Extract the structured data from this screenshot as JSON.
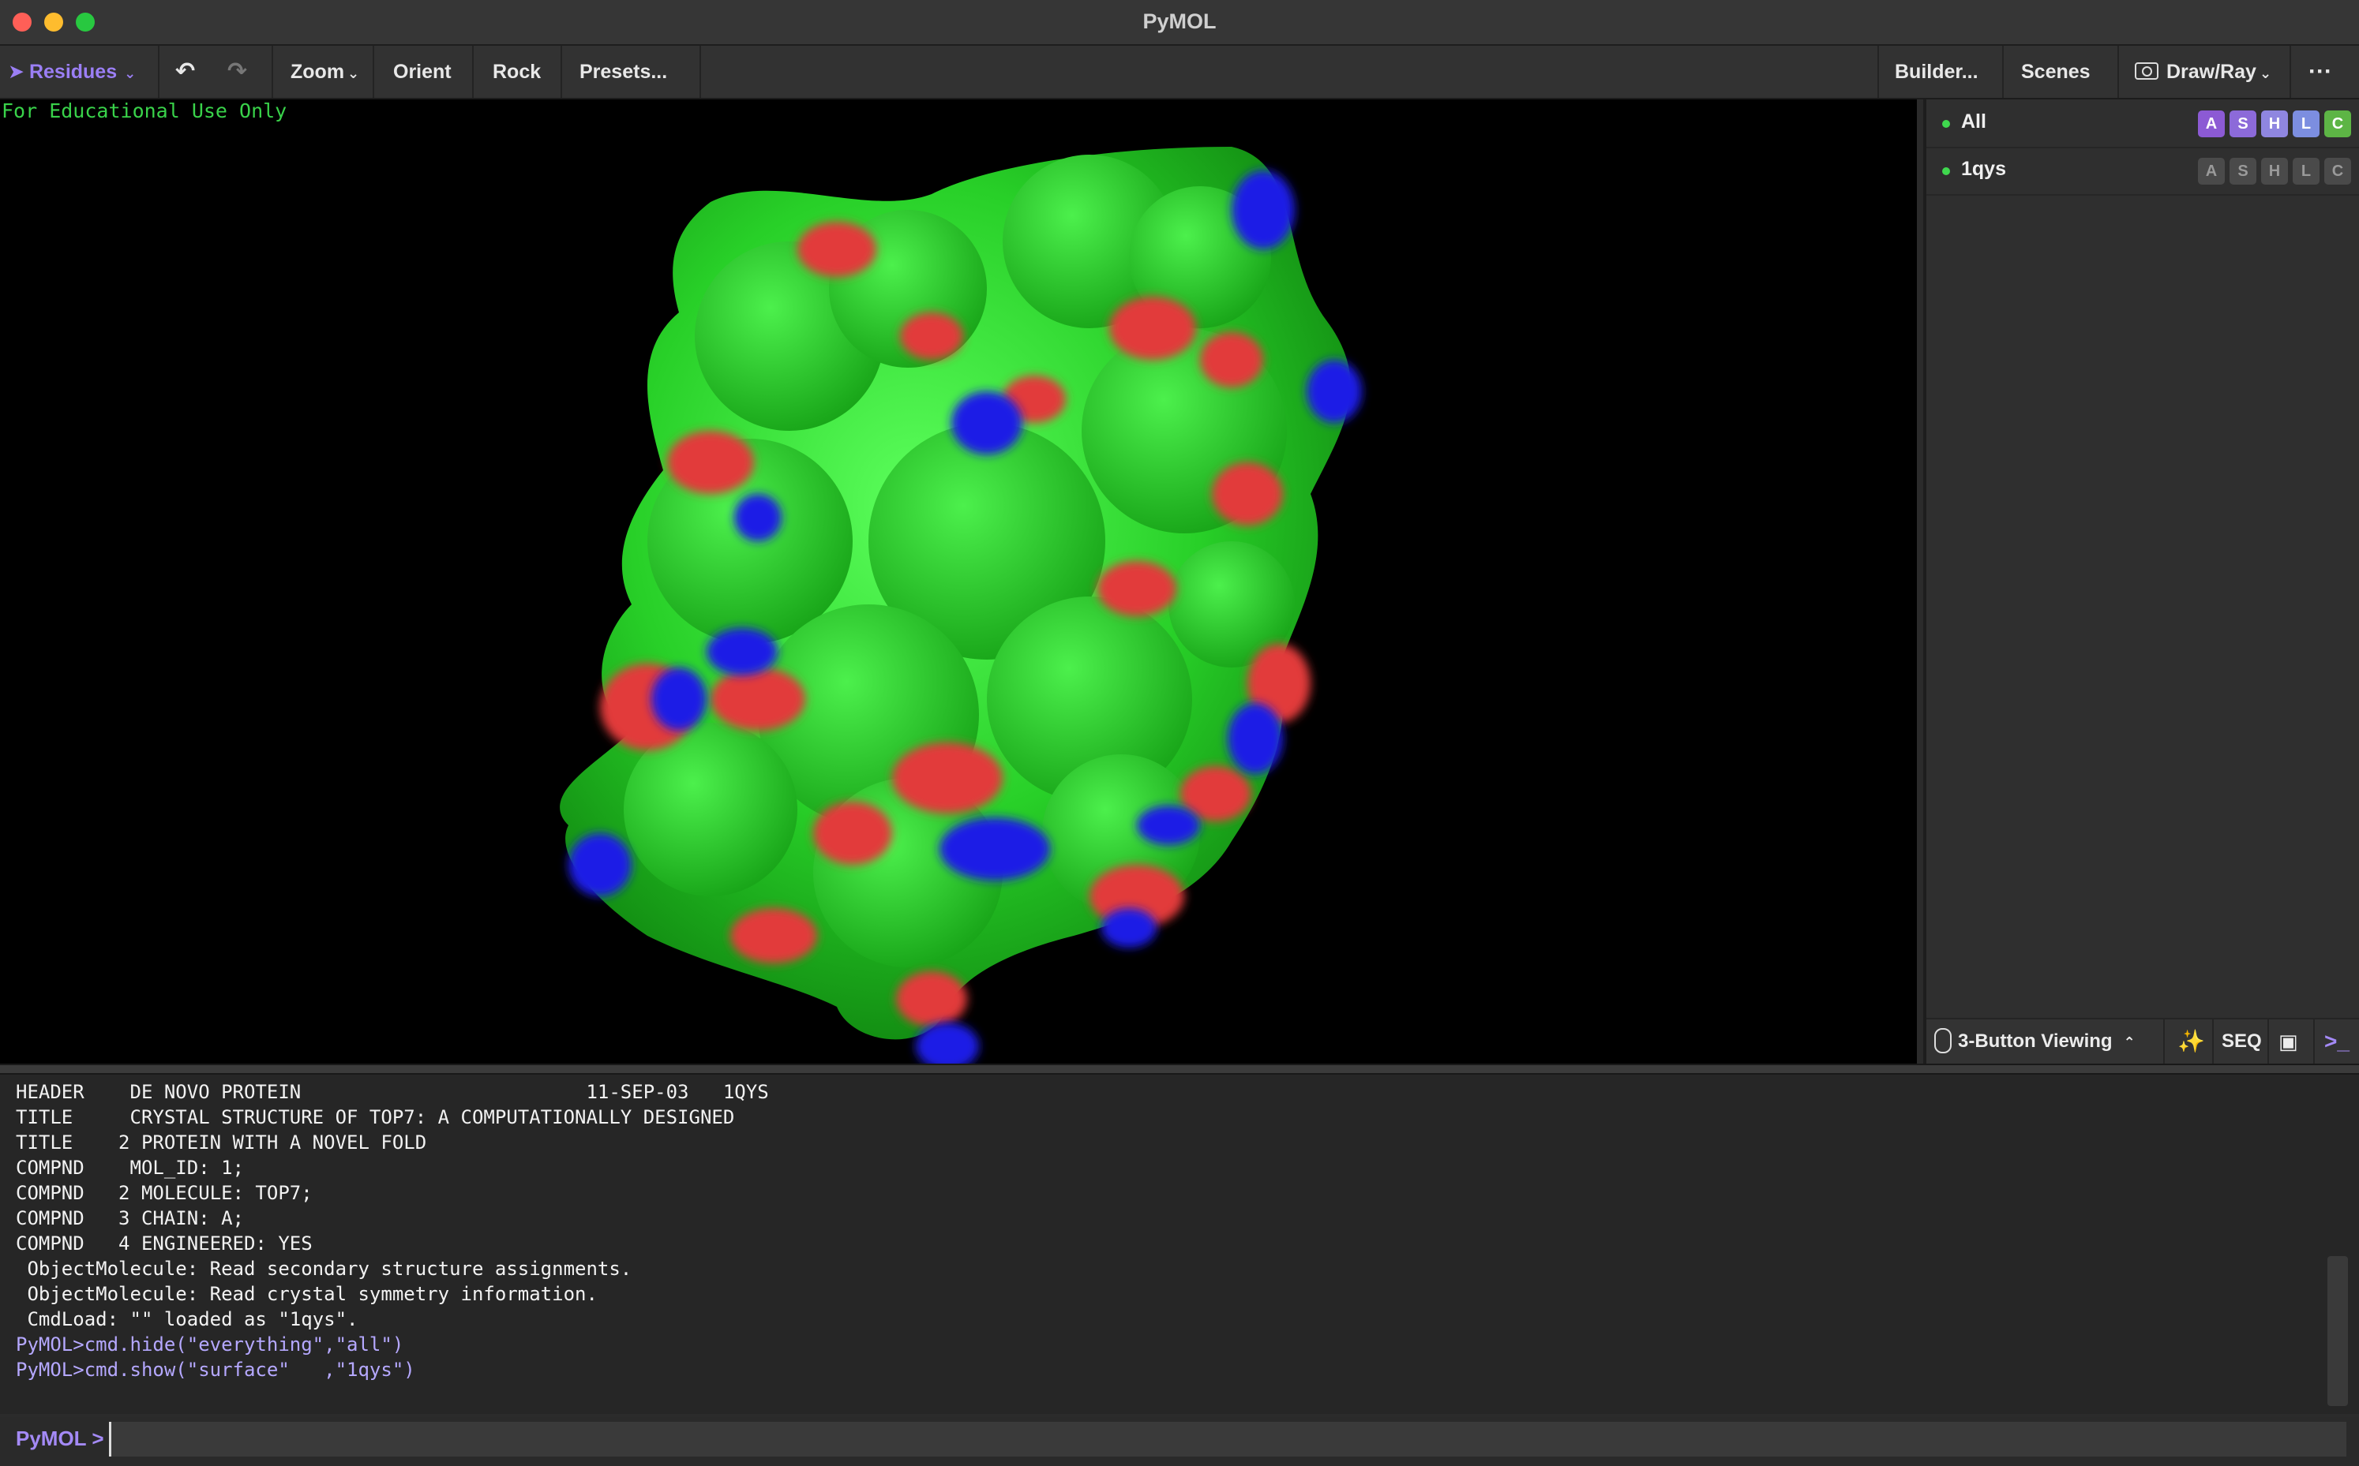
{
  "window": {
    "title": "PyMOL"
  },
  "toolbar": {
    "mode_label": "Residues",
    "zoom_label": "Zoom",
    "orient_label": "Orient",
    "rock_label": "Rock",
    "presets_label": "Presets...",
    "builder_label": "Builder...",
    "scenes_label": "Scenes",
    "drawray_label": "Draw/Ray",
    "more_label": "···"
  },
  "viewport": {
    "watermark": "For Educational Use Only"
  },
  "objects": [
    {
      "name": "All",
      "buttons": [
        "A",
        "S",
        "H",
        "L",
        "C"
      ]
    },
    {
      "name": "1qys",
      "buttons": [
        "A",
        "S",
        "H",
        "L",
        "C"
      ]
    }
  ],
  "panel_bottom": {
    "viewing_label": "3-Button Viewing",
    "seq_label": "SEQ"
  },
  "console": {
    "lines": [
      "HEADER    DE NOVO PROTEIN                         11-SEP-03   1QYS",
      "TITLE     CRYSTAL STRUCTURE OF TOP7: A COMPUTATIONALLY DESIGNED",
      "TITLE    2 PROTEIN WITH A NOVEL FOLD",
      "COMPND    MOL_ID: 1;",
      "COMPND   2 MOLECULE: TOP7;",
      "COMPND   3 CHAIN: A;",
      "COMPND   4 ENGINEERED: YES",
      " ObjectMolecule: Read secondary structure assignments.",
      " ObjectMolecule: Read crystal symmetry information.",
      " CmdLoad: \"\" loaded as \"1qys\"."
    ],
    "commands": [
      "PyMOL>cmd.hide(\"everything\",\"all\")",
      "PyMOL>cmd.show(\"surface\"   ,\"1qys\")"
    ],
    "prompt_label": "PyMOL >",
    "input_value": ""
  },
  "colors": {
    "surface_green": "#2ee02e",
    "oxygen_red": "#e53a3a",
    "nitrogen_blue": "#1e1ee8",
    "accent_purple": "#9b7ff5"
  }
}
